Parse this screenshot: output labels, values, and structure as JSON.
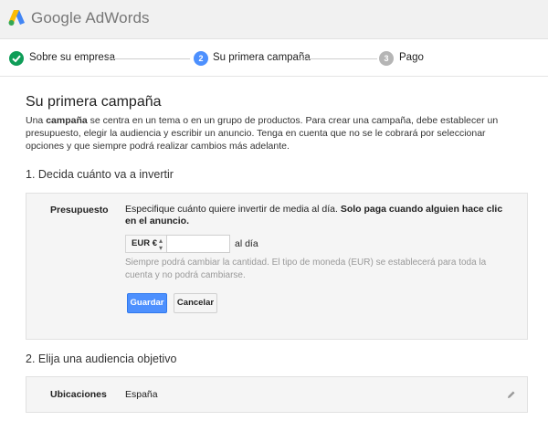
{
  "header": {
    "brand_google": "Google",
    "brand_product": "AdWords",
    "logo_colors": [
      "#fbbc05",
      "#4285f4",
      "#34a853"
    ]
  },
  "steps": [
    {
      "label": "Sobre su empresa",
      "state": "done",
      "icon": "checkmark-icon",
      "color": "#0f9d58"
    },
    {
      "label": "Su primera campaña",
      "number": "2",
      "state": "active",
      "color": "#4d90fe"
    },
    {
      "label": "Pago",
      "number": "3",
      "state": "pending",
      "color": "#b5b5b5"
    }
  ],
  "main": {
    "title": "Su primera campaña",
    "intro_prefix": "Una ",
    "intro_bold": "campaña",
    "intro_rest": " se centra en un tema o en un grupo de productos. Para crear una campaña, debe establecer un presupuesto, elegir la audiencia y escribir un anuncio. Tenga en cuenta que no se le cobrará por seleccionar opciones y que siempre podrá realizar cambios más adelante."
  },
  "budget": {
    "section_title": "1. Decida cuánto va a invertir",
    "label": "Presupuesto",
    "desc_prefix": "Especifique cuánto quiere invertir de media al día. ",
    "desc_bold": "Solo paga cuando alguien hace clic en el anuncio.",
    "currency": "EUR €",
    "amount_value": "",
    "amount_placeholder": "",
    "suffix": "al día",
    "note": "Siempre podrá cambiar la cantidad. El tipo de moneda (EUR) se establecerá para toda la cuenta y no podrá cambiarse.",
    "save_label": "Guardar",
    "cancel_label": "Cancelar"
  },
  "audience": {
    "section_title": "2. Elija una audiencia objetivo",
    "label": "Ubicaciones",
    "value": "España",
    "edit_icon": "pencil-icon"
  }
}
